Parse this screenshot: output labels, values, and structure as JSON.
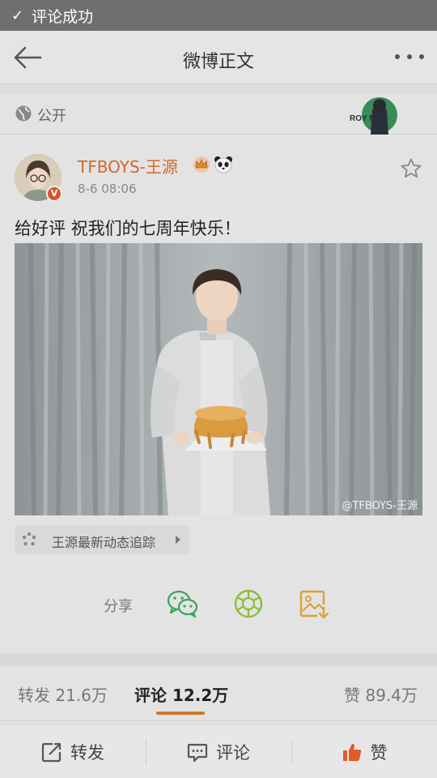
{
  "toast": {
    "text": "评论成功"
  },
  "navbar": {
    "title": "微博正文"
  },
  "visibility": {
    "label": "公开",
    "card_text": "ROY  NG"
  },
  "post": {
    "username": "TFBOYS-王源",
    "time": "8-6 08:06",
    "content": "给好评 祝我们的七周年快乐！",
    "photo_watermark": "@TFBOYS-王源",
    "tracker_label": "王源最新动态追踪"
  },
  "share": {
    "label": "分享"
  },
  "stats": {
    "repost": "转发 21.6万",
    "comments": "评论 12.2万",
    "likes": "赞 89.4万"
  },
  "bottombar": {
    "repost": "转发",
    "comment": "评论",
    "like": "赞"
  },
  "colors": {
    "accent": "#d0782e",
    "username": "#d06a2a",
    "wechat": "#3aa35a",
    "moments": "#8cbc3a",
    "save": "#e0a030",
    "like": "#e05a2a"
  }
}
